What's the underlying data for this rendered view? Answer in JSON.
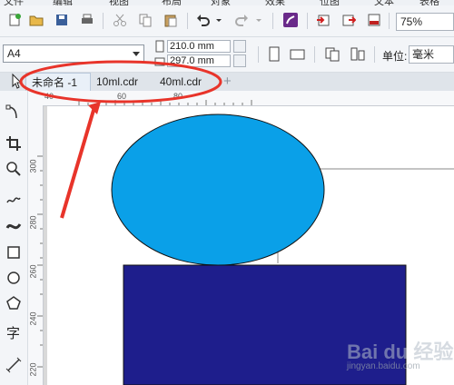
{
  "menubar": {
    "items": [
      "文件",
      "编辑",
      "视图",
      "布局",
      "对象",
      "效果",
      "位图",
      "文本",
      "表格"
    ]
  },
  "toolbar": {
    "zoom_value": "75%"
  },
  "property_bar": {
    "page_size": "A4",
    "width": "210.0 mm",
    "height": "297.0 mm",
    "unit_label": "单位:",
    "unit_value": "毫米"
  },
  "document_tabs": [
    {
      "label": "未命名 -1",
      "active": true
    },
    {
      "label": "10ml.cdr",
      "active": false
    },
    {
      "label": "40ml.cdr",
      "active": false
    }
  ],
  "rulers": {
    "horizontal": [
      "40",
      "60",
      "80"
    ],
    "vertical": [
      "300",
      "280",
      "260",
      "240",
      "220"
    ]
  },
  "shapes": {
    "ellipse_color": "#0aa0e8",
    "rectangle_color": "#1e1e8c"
  },
  "annotation_color": "#e8342a",
  "watermark": {
    "brand": "Bai du 经验",
    "url": "jingyan.baidu.com"
  }
}
